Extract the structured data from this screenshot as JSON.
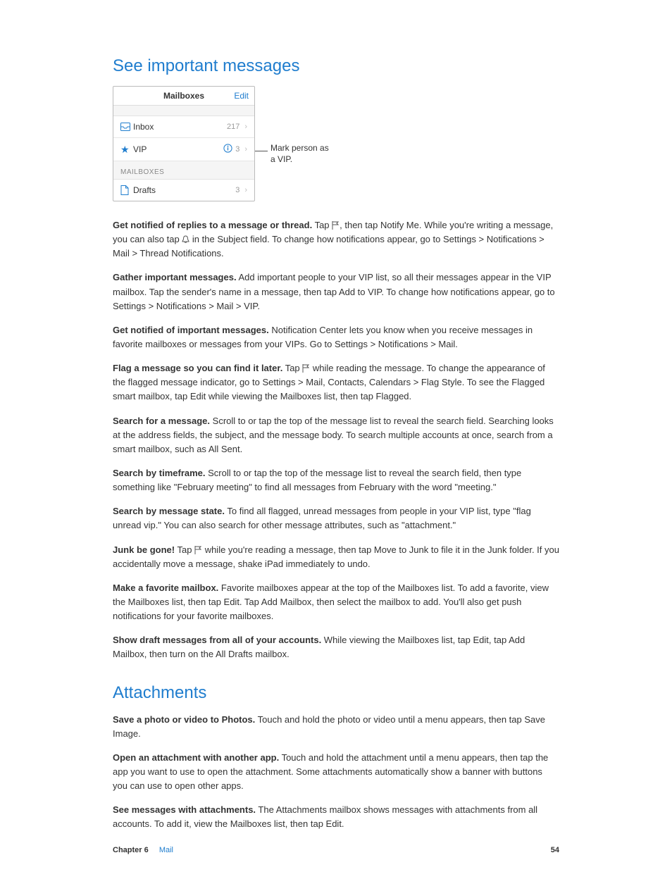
{
  "heading1": "See important messages",
  "phone": {
    "title": "Mailboxes",
    "edit": "Edit",
    "rows": {
      "inbox": {
        "label": "Inbox",
        "count": "217"
      },
      "vip": {
        "label": "VIP",
        "count": "3"
      },
      "drafts": {
        "label": "Drafts",
        "count": "3"
      }
    },
    "group": "MAILBOXES"
  },
  "callout": "Mark person as a VIP.",
  "paragraphs": {
    "p1_lead": "Get notified of replies to a message or thread.",
    "p1_a": " Tap ",
    "p1_b": ", then tap Notify Me. While you're writing a message, you can also tap ",
    "p1_c": " in the Subject field. To change how notifications appear, go to Settings > Notifications > Mail > Thread Notifications.",
    "p2_lead": "Gather important messages.",
    "p2": " Add important people to your VIP list, so all their messages appear in the VIP mailbox. Tap the sender's name in a message, then tap Add to VIP. To change how notifications appear, go to Settings > Notifications > Mail > VIP.",
    "p3_lead": "Get notified of important messages.",
    "p3": " Notification Center lets you know when you receive messages in favorite mailboxes or messages from your VIPs. Go to Settings > Notifications > Mail.",
    "p4_lead": "Flag a message so you can find it later.",
    "p4_a": " Tap ",
    "p4_b": " while reading the message. To change the appearance of the flagged message indicator, go to Settings > Mail, Contacts, Calendars > Flag Style. To see the Flagged smart mailbox, tap Edit while viewing the Mailboxes list, then tap Flagged.",
    "p5_lead": "Search for a message.",
    "p5": " Scroll to or tap the top of the message list to reveal the search field. Searching looks at the address fields, the subject, and the message body. To search multiple accounts at once, search from a smart mailbox, such as All Sent.",
    "p6_lead": "Search by timeframe.",
    "p6": " Scroll to or tap the top of the message list to reveal the search field, then type something like \"February meeting\" to find all messages from February with the word \"meeting.\"",
    "p7_lead": "Search by message state.",
    "p7": " To find all flagged, unread messages from people in your VIP list, type \"flag unread vip.\" You can also search for other message attributes, such as \"attachment.\"",
    "p8_lead": "Junk be gone!",
    "p8_a": " Tap ",
    "p8_b": " while you're reading a message, then tap Move to Junk to file it in the Junk folder. If you accidentally move a message, shake iPad immediately to undo.",
    "p9_lead": "Make a favorite mailbox.",
    "p9": " Favorite mailboxes appear at the top of the Mailboxes list. To add a favorite, view the Mailboxes list, then tap Edit. Tap Add Mailbox, then select the mailbox to add. You'll also get push notifications for your favorite mailboxes.",
    "p10_lead": "Show draft messages from all of your accounts.",
    "p10": " While viewing the Mailboxes list, tap Edit, tap Add Mailbox, then turn on the All Drafts mailbox."
  },
  "heading2": "Attachments",
  "attachments": {
    "a1_lead": "Save a photo or video to Photos.",
    "a1": " Touch and hold the photo or video until a menu appears, then tap Save Image.",
    "a2_lead": "Open an attachment with another app.",
    "a2": " Touch and hold the attachment until a menu appears, then tap the app you want to use to open the attachment. Some attachments automatically show a banner with buttons you can use to open other apps.",
    "a3_lead": "See messages with attachments.",
    "a3": " The Attachments mailbox shows messages with attachments from all accounts. To add it, view the Mailboxes list, then tap Edit."
  },
  "footer": {
    "chapter": "Chapter  6",
    "name": "Mail",
    "page": "54"
  }
}
